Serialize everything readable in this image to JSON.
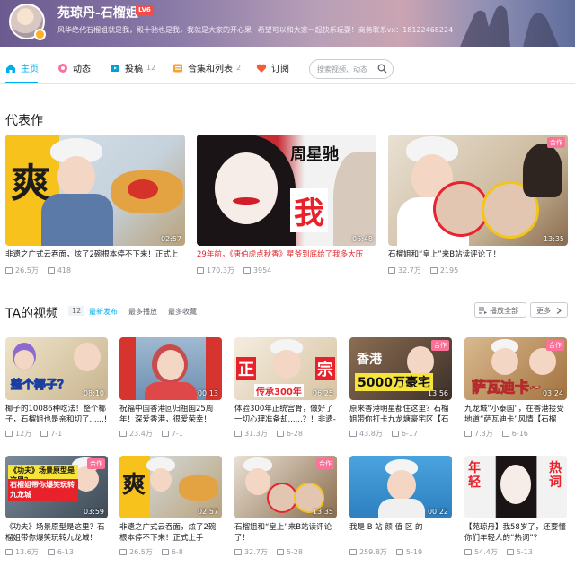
{
  "header": {
    "username": "苑琼丹-石榴姐",
    "level": "LV6",
    "bio": "风华绝代石榴姐就是我，殿十驰也是我，我就是大家的开心果~希望可以和大家一起快乐玩耍！商务联系vx：18122468224"
  },
  "nav": {
    "home": "主页",
    "dynamics": "动态",
    "posts": "投稿",
    "posts_count": "12",
    "collections": "合集和列表",
    "collections_count": "2",
    "subscriptions": "订阅",
    "search_placeholder": "搜索视频、动态"
  },
  "featured": {
    "section_title": "代表作",
    "items": [
      {
        "title": "非遗之广式云吞面，炫了2碗根本停不下来！正式上",
        "duration": "02:57",
        "views": "26.5万",
        "danmaku": "418",
        "thumb_text": "爽",
        "title_red": false
      },
      {
        "title": "29年前，《唐伯虎点秋香》星爷到底给了我多大压",
        "duration": "06:48",
        "views": "170.3万",
        "danmaku": "3954",
        "thumb_text_1": "周星驰",
        "thumb_text_2": "我",
        "title_red": true
      },
      {
        "title": "石榴姐和“皇上”来B站读评论了！",
        "duration": "13:35",
        "views": "32.7万",
        "danmaku": "2195",
        "badge": "合作",
        "title_red": false
      }
    ]
  },
  "videos": {
    "section_title": "TA的视频",
    "count": "12",
    "sort_latest": "最新发布",
    "sort_most_played": "最多播放",
    "sort_most_fav": "最多收藏",
    "play_all": "播放全部",
    "more": "更多",
    "items": [
      {
        "title": "椰子的10086种吃法！整个椰子，石榴姐也是亲和切了......!",
        "duration": "08:10",
        "views": "12万",
        "date": "7-1",
        "thumb_text": "整个椰子？"
      },
      {
        "title": "祝福中国香港回归祖国25周年！深爱香港，很爱荣幸！",
        "duration": "00:13",
        "views": "23.4万",
        "date": "7-1"
      },
      {
        "title": "体验300年正统宫骨，做好了一切心理准备却......？！非遗-石",
        "duration": "06:25",
        "views": "31.3万",
        "date": "6-28",
        "thumb_text_1": "正",
        "thumb_text_2": "宗",
        "thumb_text_3": "传承300年"
      },
      {
        "title": "原来香港明星都住这里？石榴姐带你打卡九龙塘豪宅区【石",
        "duration": "13:56",
        "views": "43.8万",
        "date": "6-17",
        "badge": "合作",
        "thumb_text_1": "香港",
        "thumb_text_2": "5000万豪宅"
      },
      {
        "title": "九龙城“小泰国”，在香港接受地道“萨瓦迪卡”风情【石榴",
        "duration": "03:24",
        "views": "7.3万",
        "date": "6-16",
        "badge": "合作",
        "thumb_text": "萨瓦迪卡~"
      },
      {
        "title": "《功夫》场景原型是这里？石榴姐带你爆笑玩转九龙城！",
        "duration": "03:59",
        "views": "13.6万",
        "date": "6-13",
        "badge": "合作",
        "thumb_text_1": "《功夫》场景原型是这里？",
        "thumb_text_2": "石榴姐带你爆笑玩转九龙城"
      },
      {
        "title": "非遗之广式云吞面，炫了2碗根本停不下来！正式上手",
        "duration": "02:57",
        "views": "26.5万",
        "date": "6-8",
        "thumb_text": "爽"
      },
      {
        "title": "石榴姐和“皇上”来B站读评论了！",
        "duration": "13:35",
        "views": "32.7万",
        "date": "5-28",
        "badge": "合作"
      },
      {
        "title": "我是 B 站 颜 值 区 的",
        "duration": "00:22",
        "views": "259.8万",
        "date": "5-19"
      },
      {
        "title": "【苑琼丹】我58岁了，还要懂你们年轻人的“热词”？",
        "duration": "",
        "views": "54.4万",
        "date": "5-13",
        "thumb_text_1": "年轻",
        "thumb_text_2": "热词"
      }
    ]
  },
  "colors": {
    "accent": "#00aeec",
    "badge": "#fb7299",
    "level": "#f04c49",
    "red_title": "#e0262b"
  }
}
